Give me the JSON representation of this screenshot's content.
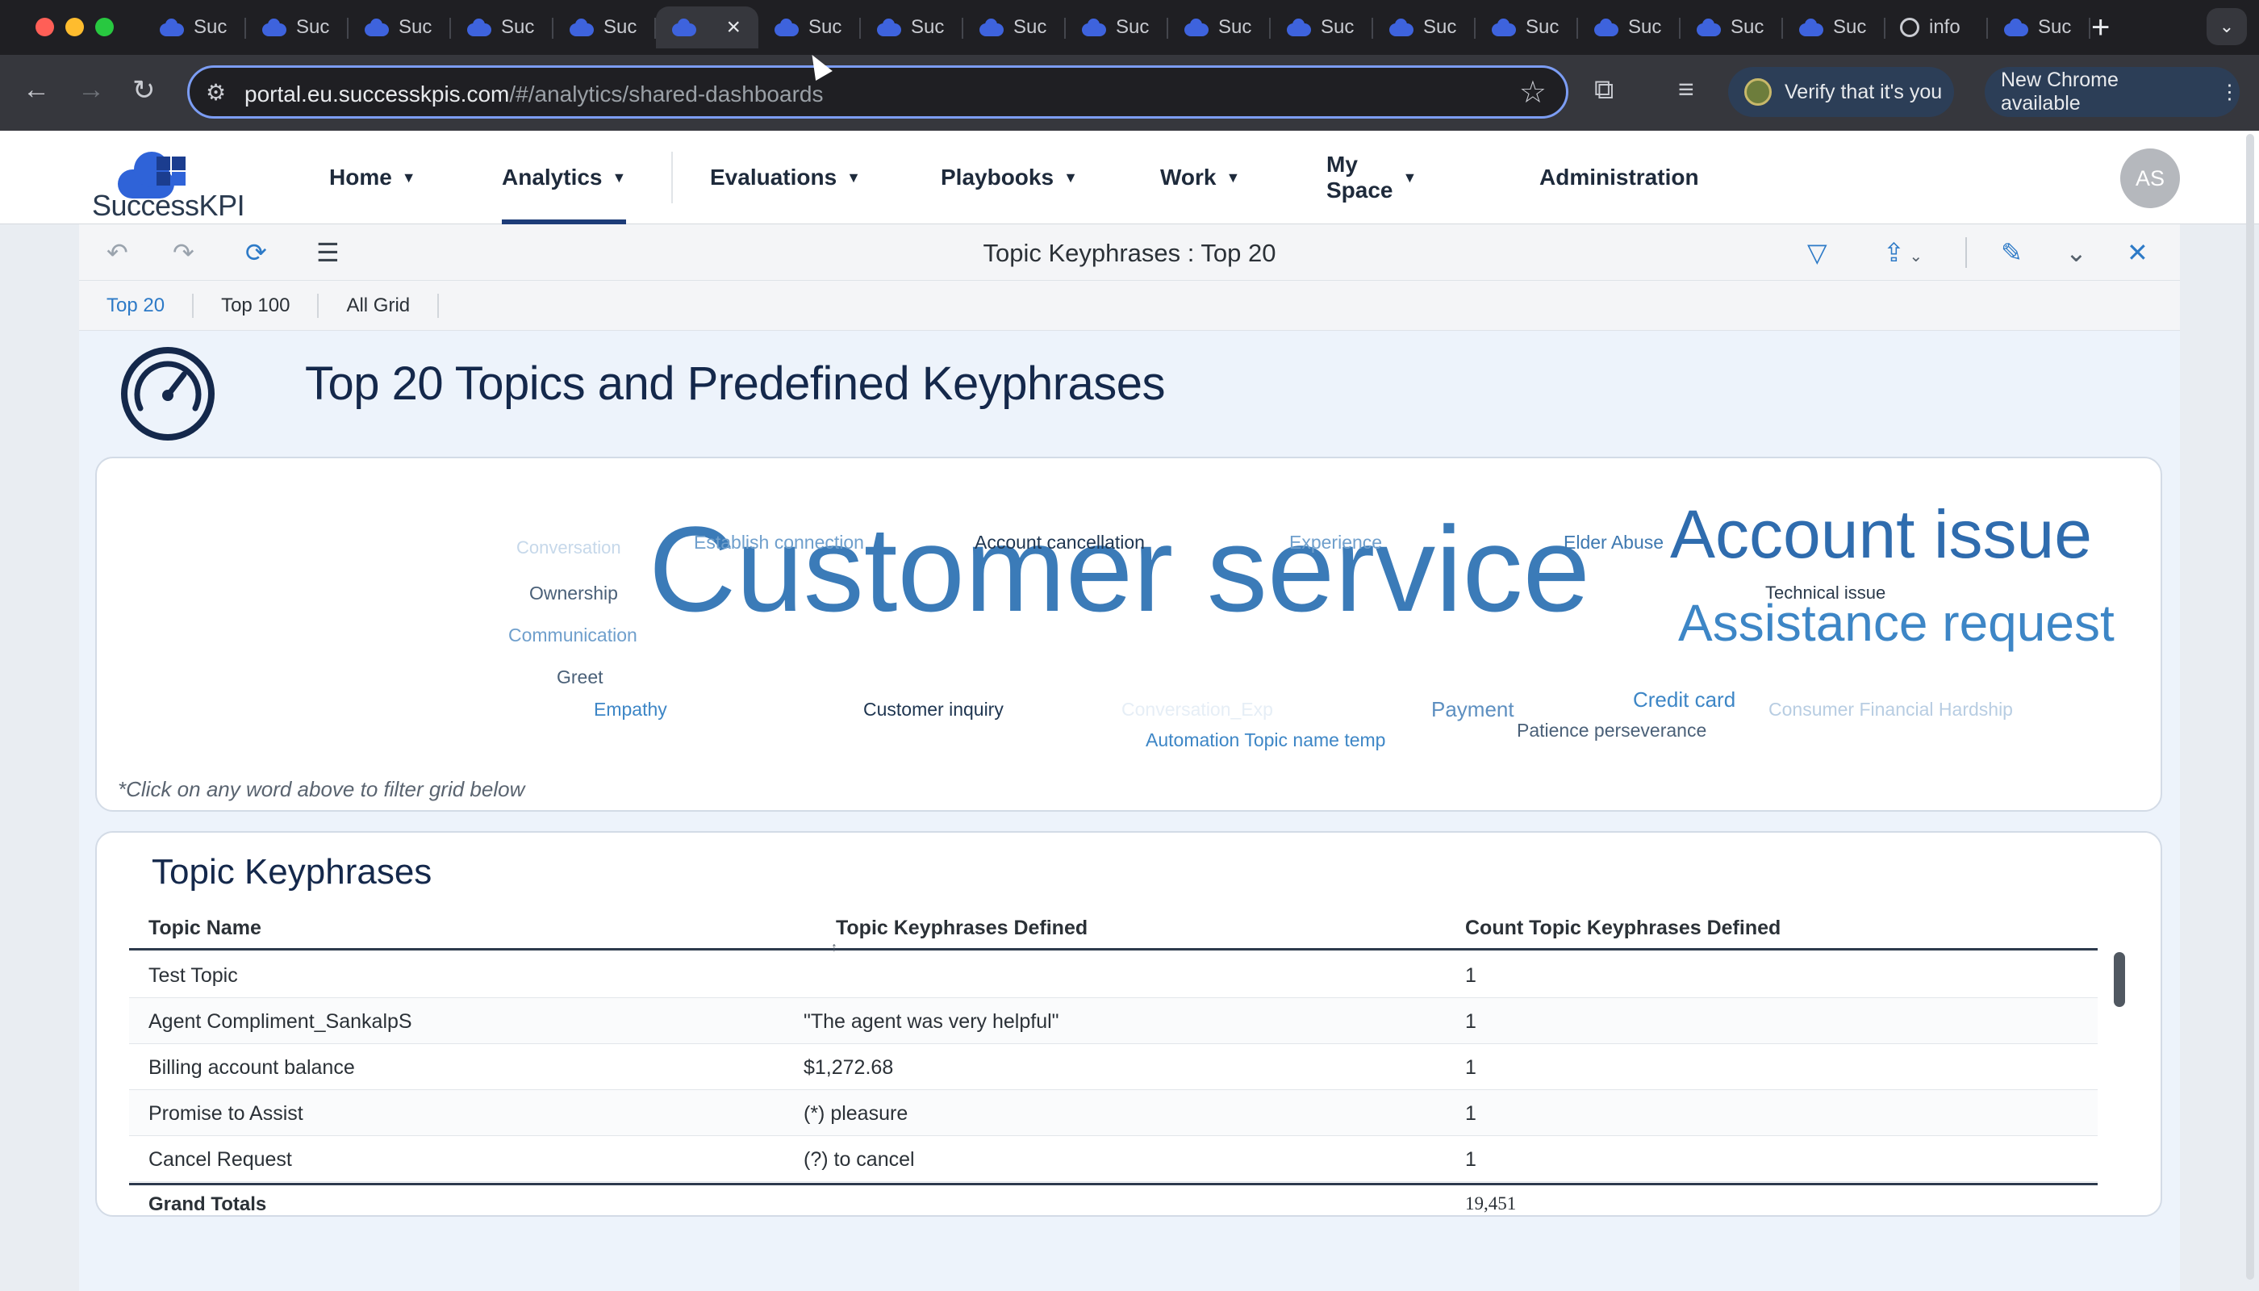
{
  "browser": {
    "tab_label": "Suc",
    "info_tab_label": "info",
    "url_host": "portal.eu.successkpis.com",
    "url_path": "/#/analytics/shared-dashboards",
    "verify_label": "Verify that it's you",
    "update_label": "New Chrome available"
  },
  "app": {
    "logo_text": "SuccessKPI",
    "nav": [
      "Home",
      "Analytics",
      "Evaluations",
      "Playbooks",
      "Work",
      "My Space",
      "Administration"
    ],
    "active_nav": "Analytics",
    "user_initials": "AS"
  },
  "panel": {
    "title": "Topic Keyphrases : Top 20",
    "tabs": [
      "Top 20",
      "Top 100",
      "All Grid"
    ],
    "active_tab": "Top 20",
    "dashboard_title": "Top 20 Topics and Predefined Keyphrases"
  },
  "word_cloud": {
    "words": [
      {
        "text": "Customer service",
        "color": "#3b7bb8"
      },
      {
        "text": "Account issue",
        "color": "#2f6cae"
      },
      {
        "text": "Assistance request",
        "color": "#3d86c6"
      },
      {
        "text": "Conversation",
        "color": "#c6d8ea"
      },
      {
        "text": "Establish connection",
        "color": "#6f9fcc"
      },
      {
        "text": "Account cancellation",
        "color": "#1e3550"
      },
      {
        "text": "Experience",
        "color": "#6f9fcc"
      },
      {
        "text": "Elder Abuse",
        "color": "#3d78b0"
      },
      {
        "text": "Ownership",
        "color": "#4a6078"
      },
      {
        "text": "Technical issue",
        "color": "#2b3a4b"
      },
      {
        "text": "Communication",
        "color": "#6f9fcc"
      },
      {
        "text": "Greet",
        "color": "#4a6078"
      },
      {
        "text": "Empathy",
        "color": "#3d86c6"
      },
      {
        "text": "Customer inquiry",
        "color": "#1e3550"
      },
      {
        "text": "Conversation_Exp",
        "color": "#e6eef6"
      },
      {
        "text": "Payment",
        "color": "#5d8fc0"
      },
      {
        "text": "Credit card",
        "color": "#3d86c6"
      },
      {
        "text": "Consumer Financial Hardship",
        "color": "#b8cde2"
      },
      {
        "text": "Automation Topic name temp",
        "color": "#3d86c6"
      },
      {
        "text": "Patience perseverance",
        "color": "#4a6078"
      }
    ],
    "note": "*Click on any word above to filter grid below"
  },
  "grid": {
    "title": "Topic Keyphrases",
    "columns": [
      "Topic Name",
      "Topic Keyphrases Defined",
      "Count Topic Keyphrases Defined"
    ],
    "rows": [
      [
        "Test Topic",
        "",
        "1"
      ],
      [
        "Agent Compliment_SankalpS",
        "\"The agent was very helpful\"",
        "1"
      ],
      [
        "Billing account balance",
        "$1,272.68",
        "1"
      ],
      [
        "Promise to Assist",
        "(*) pleasure",
        "1"
      ],
      [
        "Cancel Request",
        "(?) to cancel",
        "1"
      ]
    ],
    "totals_label": "Grand Totals",
    "totals_value": "19,451"
  }
}
